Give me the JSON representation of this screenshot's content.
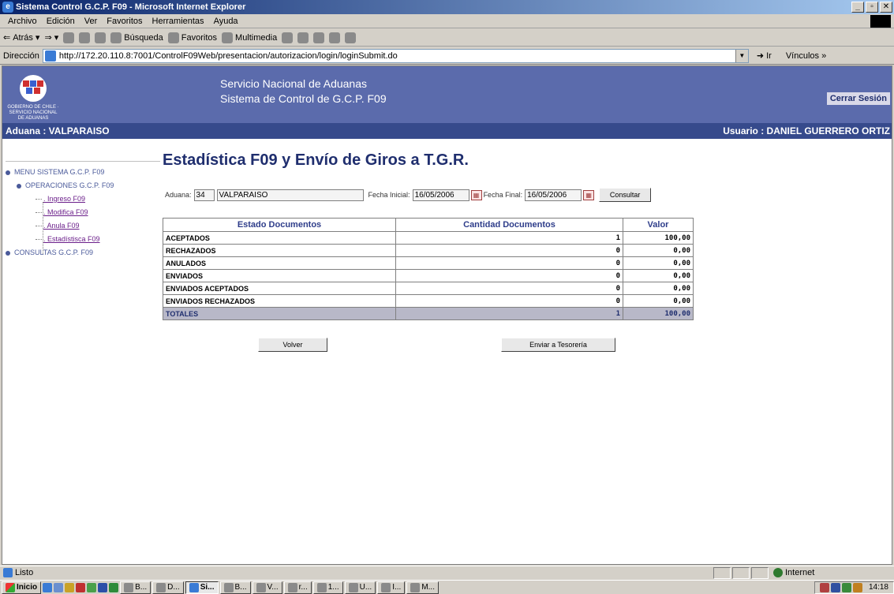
{
  "window": {
    "title": "Sistema Control G.C.P. F09 - Microsoft Internet Explorer",
    "buttons": [
      "_",
      "▫",
      "✕"
    ]
  },
  "menubar": [
    "Archivo",
    "Edición",
    "Ver",
    "Favoritos",
    "Herramientas",
    "Ayuda"
  ],
  "toolbar": {
    "back": "Atrás",
    "search": "Búsqueda",
    "favorites": "Favoritos",
    "multimedia": "Multimedia"
  },
  "address": {
    "label": "Dirección",
    "url": "http://172.20.110.8:7001/ControlF09Web/presentacion/autorizacion/login/loginSubmit.do",
    "go": "Ir",
    "links": "Vínculos"
  },
  "header": {
    "logo_caption": "GOBIERNO DE CHILE · SERVICIO NACIONAL DE ADUANAS",
    "line1": "Servicio Nacional de Aduanas",
    "line2": "Sistema de Control de G.C.P. F09",
    "logout": "Cerrar Sesión",
    "aduana": "Aduana : VALPARAISO",
    "user": "Usuario : DANIEL GUERRERO ORTIZ"
  },
  "sidemenu": {
    "root": "MENU SISTEMA G.C.P. F09",
    "operaciones": "OPERACIONES G.C.P. F09",
    "items": [
      ". Ingreso F09",
      ". Modifica F09",
      ". Anula F09",
      ". Estadístisca F09"
    ],
    "consultas": "CONSULTAS G.C.P. F09"
  },
  "main": {
    "title": "Estadística F09 y Envío de Giros a T.G.R.",
    "aduana_label": "Aduana:",
    "aduana_code": "34",
    "aduana_name": "VALPARAISO",
    "fecha_inicial_label": "Fecha Inicial:",
    "fecha_inicial": "16/05/2006",
    "fecha_final_label": "Fecha Final:",
    "fecha_final": "16/05/2006",
    "consultar": "Consultar",
    "table": {
      "headers": [
        "Estado Documentos",
        "Cantidad Documentos",
        "Valor"
      ],
      "rows": [
        [
          "ACEPTADOS",
          "1",
          "100,00"
        ],
        [
          "RECHAZADOS",
          "0",
          "0,00"
        ],
        [
          "ANULADOS",
          "0",
          "0,00"
        ],
        [
          "ENVIADOS",
          "0",
          "0,00"
        ],
        [
          "ENVIADOS ACEPTADOS",
          "0",
          "0,00"
        ],
        [
          "ENVIADOS RECHAZADOS",
          "0",
          "0,00"
        ]
      ],
      "total": [
        "TOTALES",
        "1",
        "100,00"
      ]
    },
    "volver": "Volver",
    "enviar": "Enviar a Tesorería"
  },
  "statusbar": {
    "status": "Listo",
    "zone": "Internet"
  },
  "taskbar": {
    "start": "Inicio",
    "tasks": [
      "B...",
      "D...",
      "Si...",
      "B...",
      "V...",
      "r...",
      "1...",
      "U...",
      "I...",
      "M..."
    ],
    "clock": "14:18"
  }
}
